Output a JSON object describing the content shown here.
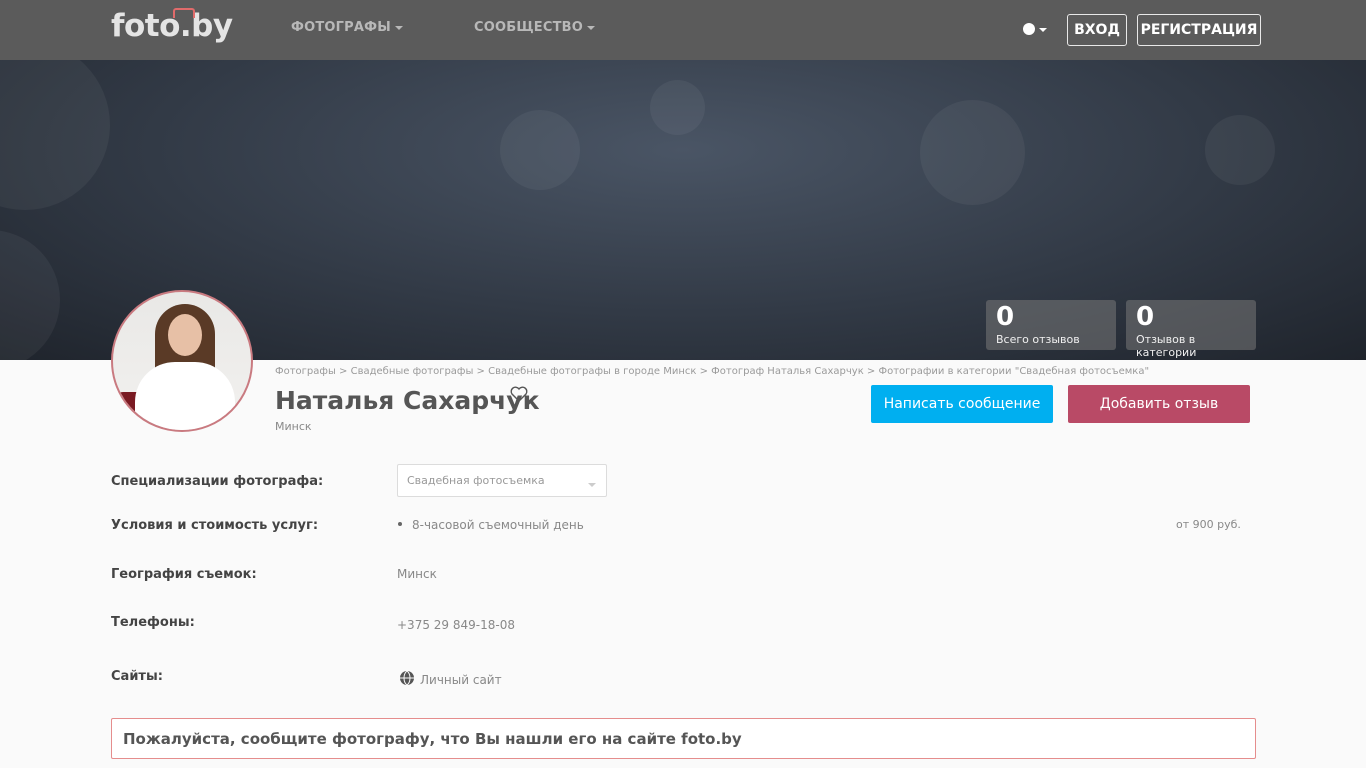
{
  "header": {
    "logo": "foto.by",
    "nav": [
      "ФОТОГРАФЫ",
      "СООБЩЕСТВО"
    ],
    "login_label": "ВХОД",
    "register_label": "РЕГИСТРАЦИЯ",
    "language_icon": "globe-icon"
  },
  "stats": [
    {
      "value": "0",
      "label": "Всего отзывов"
    },
    {
      "value": "0",
      "label": "Отзывов в категории"
    }
  ],
  "breadcrumb": "Фотографы > Свадебные фотографы > Свадебные фотографы в городе Минск > Фотограф Наталья Сахарчук > Фотографии в категории \"Свадебная фотосъемка\"",
  "profile": {
    "name": "Наталья Сахарчук",
    "city": "Минск",
    "favorite_icon": "heart-outline-icon"
  },
  "actions": {
    "message_label": "Написать сообщение",
    "review_label": "Добавить отзыв"
  },
  "details": {
    "specialization_label": "Специализации фотографа:",
    "specialization_value": "Свадебная фотосъемка",
    "services_label": "Условия и стоимость услуг:",
    "service_item": "8-часовой съемочный день",
    "service_price": "от 900 руб.",
    "geography_label": "География съемок:",
    "geography_value": "Минск",
    "phones_label": "Телефоны:",
    "phones_value": "+375 29 849-18-08",
    "sites_label": "Сайты:",
    "sites_value": "Личный сайт",
    "sites_icon": "globe-icon"
  },
  "notice": "Пожалуйста, сообщите фотографу, что Вы нашли его на сайте foto.by",
  "colors": {
    "header_bg": "#5b5b5b",
    "message_button": "#00aff0",
    "review_button": "#b94a66",
    "notice_border": "#e58d8d"
  }
}
